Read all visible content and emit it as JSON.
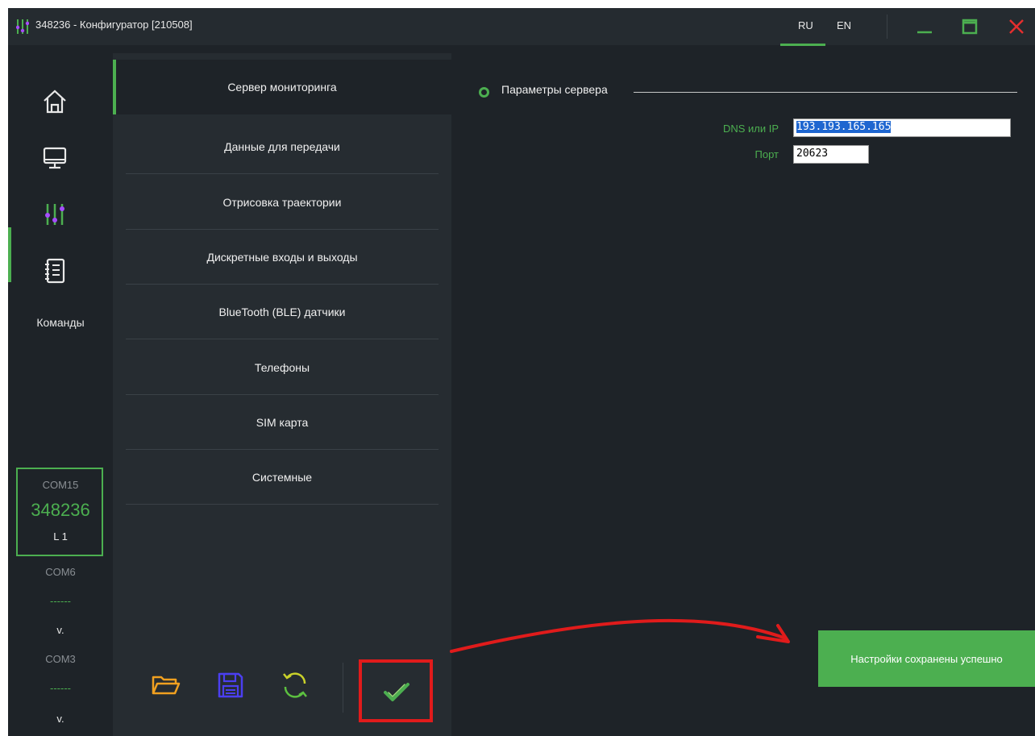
{
  "titlebar": {
    "title": "348236 - Конфигуратор [210508]",
    "languages": [
      "RU",
      "EN"
    ],
    "active_language": "RU"
  },
  "rail": {
    "commands_label": "Команды",
    "ports": [
      {
        "name": "COM15",
        "id": "348236",
        "line": "L 1"
      },
      {
        "name": "COM6",
        "id": "------",
        "line": "v."
      },
      {
        "name": "COM3",
        "id": "------",
        "line": "v."
      }
    ]
  },
  "menu": {
    "items": [
      "Сервер мониторинга",
      "Данные для передачи",
      "Отрисовка траектории",
      "Дискретные входы и выходы",
      "BlueTooth (BLE) датчики",
      "Телефоны",
      "SIM карта",
      "Системные"
    ],
    "active_index": 0
  },
  "content": {
    "section_title": "Параметры сервера",
    "fields": {
      "dns_label": "DNS или IP",
      "dns_value": "193.193.165.165",
      "port_label": "Порт",
      "port_value": "20623"
    }
  },
  "toast": {
    "message": "Настройки сохранены успешно"
  },
  "colors": {
    "accent": "#4caf50",
    "background": "#1e2328",
    "panel": "#262c31",
    "annotation": "#e01b1b"
  },
  "icons": [
    "app-logo-icon",
    "home-icon",
    "monitor-icon",
    "sliders-icon",
    "notebook-icon",
    "minimize-icon",
    "maximize-icon",
    "close-icon",
    "folder-open-icon",
    "save-icon",
    "refresh-icon",
    "checkmark-icon"
  ]
}
